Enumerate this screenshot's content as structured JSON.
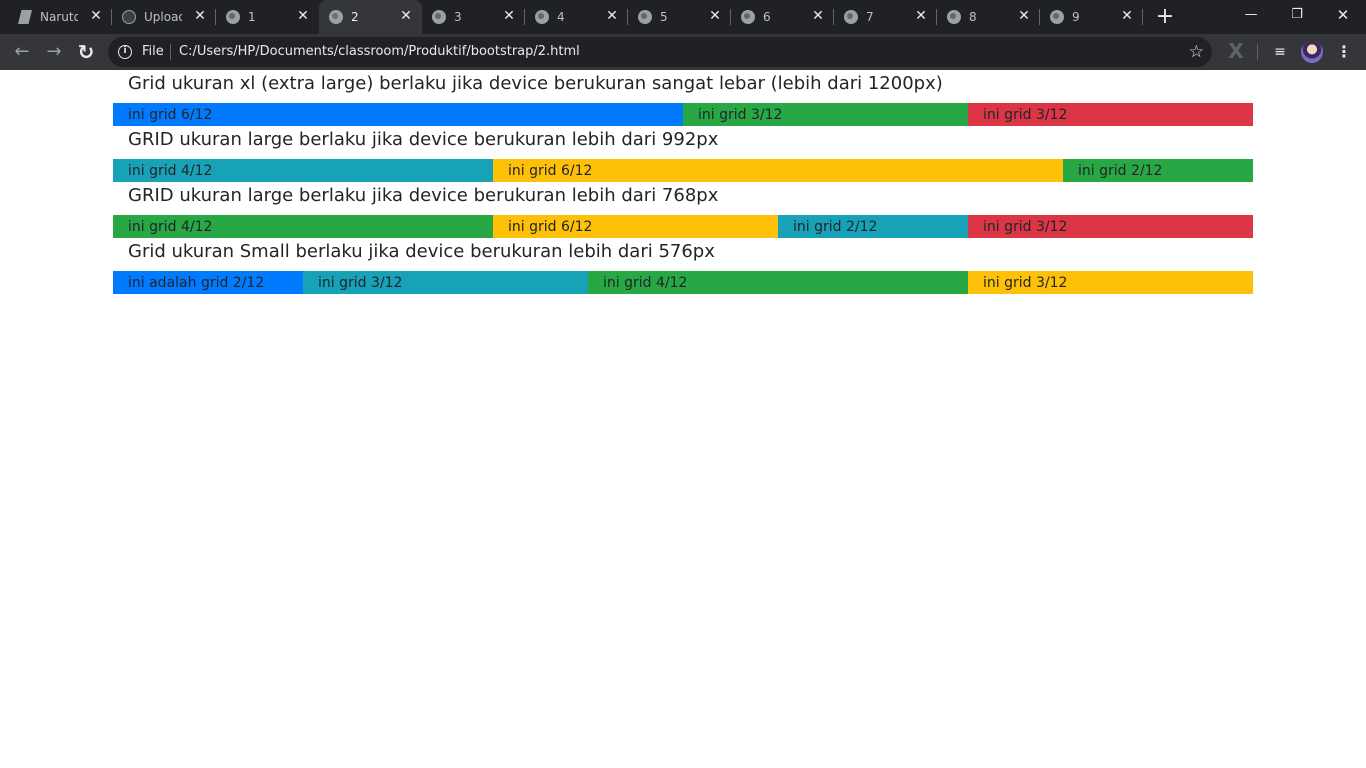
{
  "browser": {
    "tabs": [
      {
        "title": "Naruto",
        "icon": "document-icon"
      },
      {
        "title": "Upload",
        "icon": "github-icon"
      },
      {
        "title": "1",
        "icon": "globe-icon"
      },
      {
        "title": "2",
        "icon": "globe-icon",
        "active": true
      },
      {
        "title": "3",
        "icon": "globe-icon"
      },
      {
        "title": "4",
        "icon": "globe-icon"
      },
      {
        "title": "5",
        "icon": "globe-icon"
      },
      {
        "title": "6",
        "icon": "globe-icon"
      },
      {
        "title": "7",
        "icon": "globe-icon"
      },
      {
        "title": "8",
        "icon": "globe-icon"
      },
      {
        "title": "9",
        "icon": "globe-icon"
      }
    ],
    "close_glyph": "✕",
    "new_tab_glyph": "+",
    "window": {
      "minimize": "—",
      "restore": "❐",
      "close": "✕"
    },
    "nav": {
      "back": "←",
      "forward": "→",
      "reload": "↻"
    },
    "omnibox": {
      "scheme_label": "File",
      "url": "C:/Users/HP/Documents/classroom/Produktif/bootstrap/2.html",
      "star": "☆"
    },
    "extension_glyph": "X",
    "media_glyph": "≡",
    "menu_glyph": "⋮"
  },
  "colors": {
    "primary": "#007bff",
    "success": "#28a745",
    "danger": "#dc3545",
    "info": "#17a2b8",
    "warning": "#ffc107",
    "chrome_dark": "#202124",
    "chrome_toolbar": "#35363a"
  },
  "sections": [
    {
      "heading": "Grid ukuran xl (extra large) berlaku jika device berukuran sangat lebar (lebih dari 1200px)",
      "cells": [
        {
          "label": "ini grid 6/12",
          "color": "primary"
        },
        {
          "label": "ini grid 3/12",
          "color": "success"
        },
        {
          "label": "ini grid 3/12",
          "color": "danger"
        }
      ]
    },
    {
      "heading": "GRID ukuran large berlaku jika device berukuran lebih dari 992px",
      "cells": [
        {
          "label": "ini grid 4/12",
          "color": "info"
        },
        {
          "label": "ini grid 6/12",
          "color": "warning"
        },
        {
          "label": "ini grid 2/12",
          "color": "success"
        }
      ]
    },
    {
      "heading": "GRID ukuran large berlaku jika device berukuran lebih dari 768px",
      "cells": [
        {
          "label": "ini grid 4/12",
          "color": "success"
        },
        {
          "label": "ini grid 6/12",
          "color": "warning"
        },
        {
          "label": "ini grid 2/12",
          "color": "info"
        },
        {
          "label": "ini grid 3/12",
          "color": "danger"
        }
      ]
    },
    {
      "heading": "Grid ukuran Small berlaku jika device berukuran lebih dari 576px",
      "cells": [
        {
          "label": "ini adalah grid 2/12",
          "color": "primary"
        },
        {
          "label": "ini grid 3/12",
          "color": "info"
        },
        {
          "label": "ini grid 4/12",
          "color": "success"
        },
        {
          "label": "ini grid 3/12",
          "color": "warning"
        }
      ]
    }
  ]
}
